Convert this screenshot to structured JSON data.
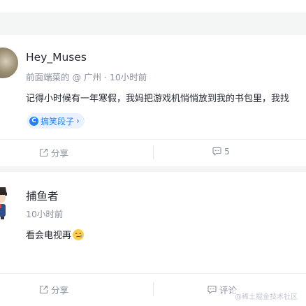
{
  "posts": [
    {
      "username": "Hey_Muses",
      "meta": "前面端菜的 @ 广州 · 10小时前",
      "content": "记得小时候有一年寒假，我妈把游戏机悄悄放到我的书包里，我找",
      "tag": "搞笑段子",
      "tag_chevron": "›",
      "actions": {
        "share": "分享",
        "comment": "5"
      }
    },
    {
      "username": "捕鱼者",
      "meta": "10小时前",
      "content": "看会电视再",
      "actions": {
        "share": "分享",
        "comment": "评论"
      }
    }
  ],
  "watermark": "@稀土掘金技术社区",
  "colors": {
    "accent": "#1e80ff",
    "text": "#252933",
    "muted": "#8a919f",
    "background": "#f4f5f5"
  },
  "icons": [
    "share-icon",
    "comment-icon",
    "topic-icon",
    "emoji-icon",
    "avatar"
  ]
}
